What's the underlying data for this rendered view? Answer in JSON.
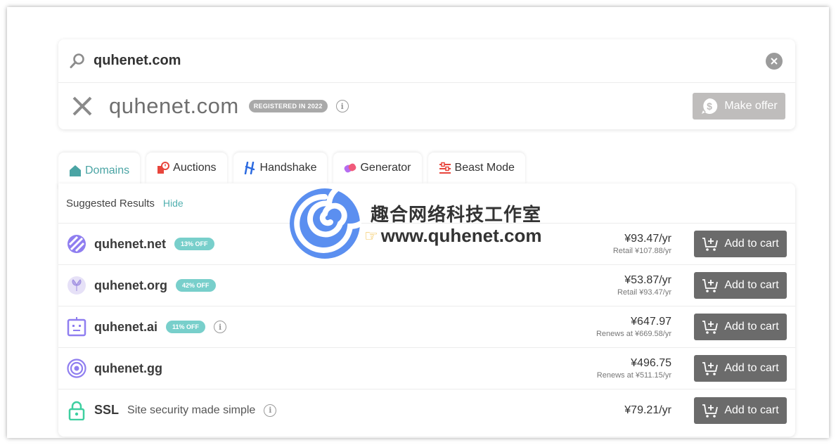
{
  "search": {
    "query": "quhenet.com"
  },
  "lookup": {
    "domain": "quhenet.com",
    "badge": "REGISTERED IN 2022",
    "make_offer_label": "Make offer"
  },
  "tabs": [
    {
      "label": "Domains",
      "icon": "home-icon",
      "active": true
    },
    {
      "label": "Auctions",
      "icon": "auction-clock-icon",
      "active": false
    },
    {
      "label": "Handshake",
      "icon": "handshake-h-icon",
      "active": false
    },
    {
      "label": "Generator",
      "icon": "generator-icon",
      "active": false
    },
    {
      "label": "Beast Mode",
      "icon": "sliders-icon",
      "active": false
    }
  ],
  "results": {
    "title": "Suggested Results",
    "hide_label": "Hide",
    "add_to_cart_label": "Add to cart",
    "rows": [
      {
        "domain": "quhenet.net",
        "badge": "13% OFF",
        "price": "¥93.47/yr",
        "sub": "Retail ¥107.88/yr",
        "icon": "net-tld-icon"
      },
      {
        "domain": "quhenet.org",
        "badge": "42% OFF",
        "price": "¥53.87/yr",
        "sub": "Retail ¥93.47/yr",
        "icon": "org-tld-icon"
      },
      {
        "domain": "quhenet.ai",
        "badge": "11% OFF",
        "price": "¥647.97",
        "sub": "Renews at ¥669.58/yr",
        "icon": "ai-tld-icon"
      },
      {
        "domain": "quhenet.gg",
        "badge": "",
        "price": "¥496.75",
        "sub": "Renews at ¥511.15/yr",
        "icon": "gg-tld-icon"
      },
      {
        "domain": "SSL",
        "subtitle": "Site security made simple",
        "price": "¥79.21/yr",
        "sub": "",
        "icon": "lock-icon"
      }
    ]
  },
  "watermark": {
    "title": "趣合网络科技工作室",
    "url": "www.quhenet.com"
  },
  "colors": {
    "accent": "#4aa4a4",
    "badge_teal": "#78cfcb",
    "cart_button": "#6b6b6b",
    "offer_button": "#bfbdbc",
    "watermark_blue": "#5b8ff0"
  }
}
